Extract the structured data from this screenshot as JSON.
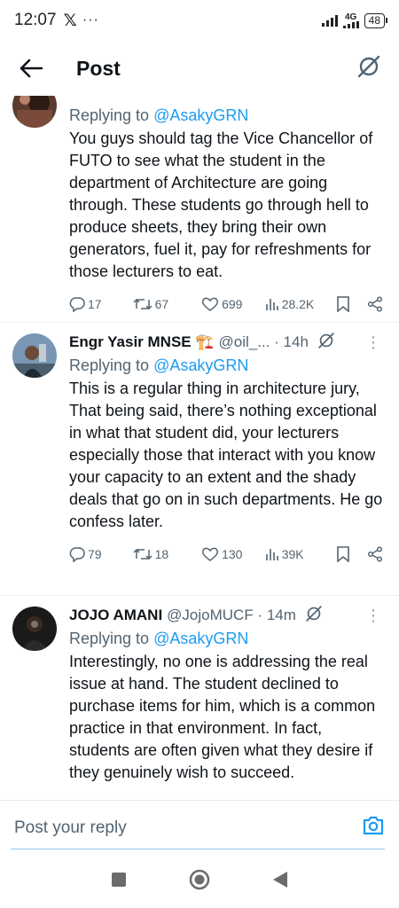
{
  "status_bar": {
    "time": "12:07",
    "x_logo": "𝕏",
    "dots": "···",
    "network": "4G",
    "battery": "48"
  },
  "header": {
    "title": "Post",
    "back_icon": "arrow-left-icon",
    "grok_icon": "grok-icon"
  },
  "tweets": [
    {
      "name": "",
      "handle": "",
      "time": "",
      "replying_prefix": "Replying to ",
      "replying_to": "@AsakyGRN",
      "text": "You guys should tag the Vice Chancellor of FUTO to see what the student in the department of Architecture are going through. These students go through hell to produce sheets, they bring their own generators, fuel it, pay for refreshments for those lecturers to eat.",
      "replies": "17",
      "reposts": "67",
      "likes": "699",
      "views": "28.2K"
    },
    {
      "name": "Engr Yasir MNSE 🏗️",
      "handle": "@oil_... · 14h",
      "replying_prefix": "Replying to ",
      "replying_to": "@AsakyGRN",
      "text": "This is a regular thing in architecture jury, That being said, there’s nothing exceptional in what  that student did, your lecturers especially those that interact with you know your capacity to an extent and the shady deals that go on in such departments. He go confess later.",
      "replies": "79",
      "reposts": "18",
      "likes": "130",
      "views": "39K"
    },
    {
      "name": "JOJO AMANI",
      "handle": "@JojoMUCF · 14m",
      "replying_prefix": "Replying to ",
      "replying_to": "@AsakyGRN",
      "text": "Interestingly, no one is addressing the real issue at hand. The student declined to purchase items for him, which is a common practice in that environment. In fact, students are often given what they desire if they genuinely wish to succeed.",
      "replies": "",
      "reposts": "",
      "likes": "",
      "views": ""
    }
  ],
  "reply_bar": {
    "placeholder": "Post your reply"
  },
  "colors": {
    "accent": "#1d9bf0",
    "text": "#0f1419",
    "secondary": "#536471"
  }
}
